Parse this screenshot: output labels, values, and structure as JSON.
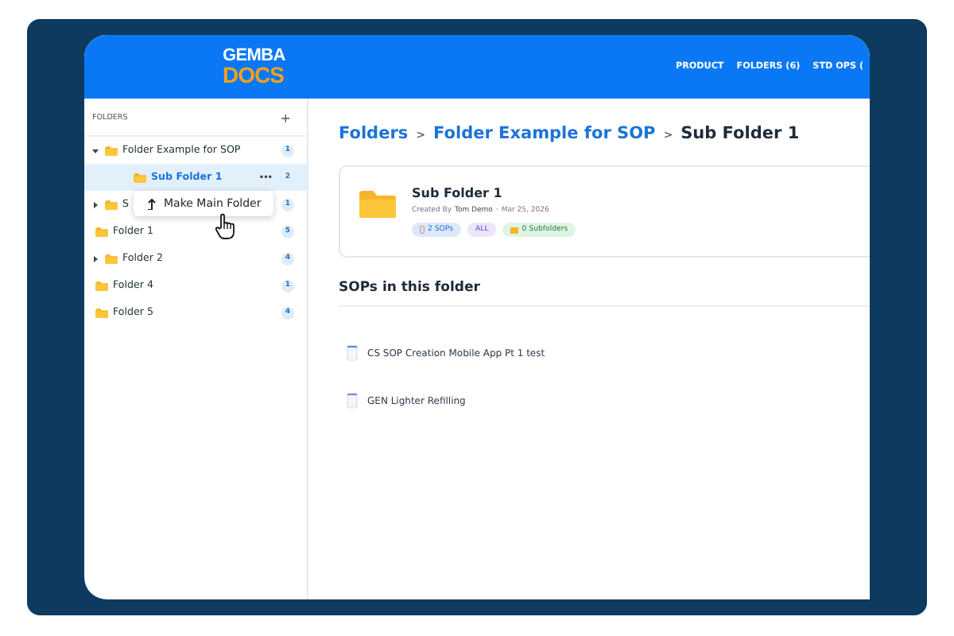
{
  "header": {
    "logo_top": "GEMBA",
    "logo_bottom": "DOCS",
    "nav": [
      "PRODUCT",
      "FOLDERS (6)",
      "STD OPS ("
    ]
  },
  "sidebar": {
    "title": "FOLDERS",
    "add": "+",
    "tree": [
      {
        "label": "Folder Example for SOP",
        "count": "1",
        "kind": "expandable",
        "expanded": true,
        "selected": false,
        "children": [
          {
            "label": "Sub Folder 1",
            "count": "2",
            "selected": true,
            "more": "•••"
          }
        ]
      },
      {
        "label": "S",
        "count": "1",
        "kind": "expandable",
        "expanded": false,
        "selected": false
      },
      {
        "label": "Folder 1",
        "count": "5",
        "kind": "leaf",
        "selected": false
      },
      {
        "label": "Folder 2",
        "count": "4",
        "kind": "expandable",
        "expanded": false,
        "selected": false
      },
      {
        "label": "Folder 4",
        "count": "1",
        "kind": "leaf",
        "selected": false
      },
      {
        "label": "Folder 5",
        "count": "4",
        "kind": "leaf",
        "selected": false
      }
    ],
    "context_menu": {
      "label": "Make Main Folder"
    }
  },
  "main": {
    "breadcrumb": [
      {
        "label": "Folders",
        "kind": "link"
      },
      {
        "label": ">",
        "kind": "separator"
      },
      {
        "label": "Folder Example for SOP",
        "kind": "link"
      },
      {
        "label": ">",
        "kind": "separator"
      },
      {
        "label": "Sub Folder 1",
        "kind": "current"
      }
    ],
    "folder_card": {
      "title": "Sub Folder 1",
      "created_label": "Created By",
      "author": "Tom Demo",
      "separator": "·",
      "date": "Mar 25, 2026",
      "tags": [
        {
          "text": "2 SOPs",
          "kind": "sops",
          "color": "#dce9fb"
        },
        {
          "text": "ALL",
          "kind": "plain",
          "color": "#ece6f9"
        },
        {
          "text": "0 Subfolders",
          "kind": "folders",
          "color": "#dff4e4"
        }
      ]
    },
    "section_title": "SOPs in this folder",
    "sops": [
      {
        "title": "CS SOP Creation Mobile App Pt 1 test",
        "color": "#4a8ef0"
      },
      {
        "title": "GEN Lighter Refilling",
        "color": "#9a7ae8"
      }
    ]
  }
}
